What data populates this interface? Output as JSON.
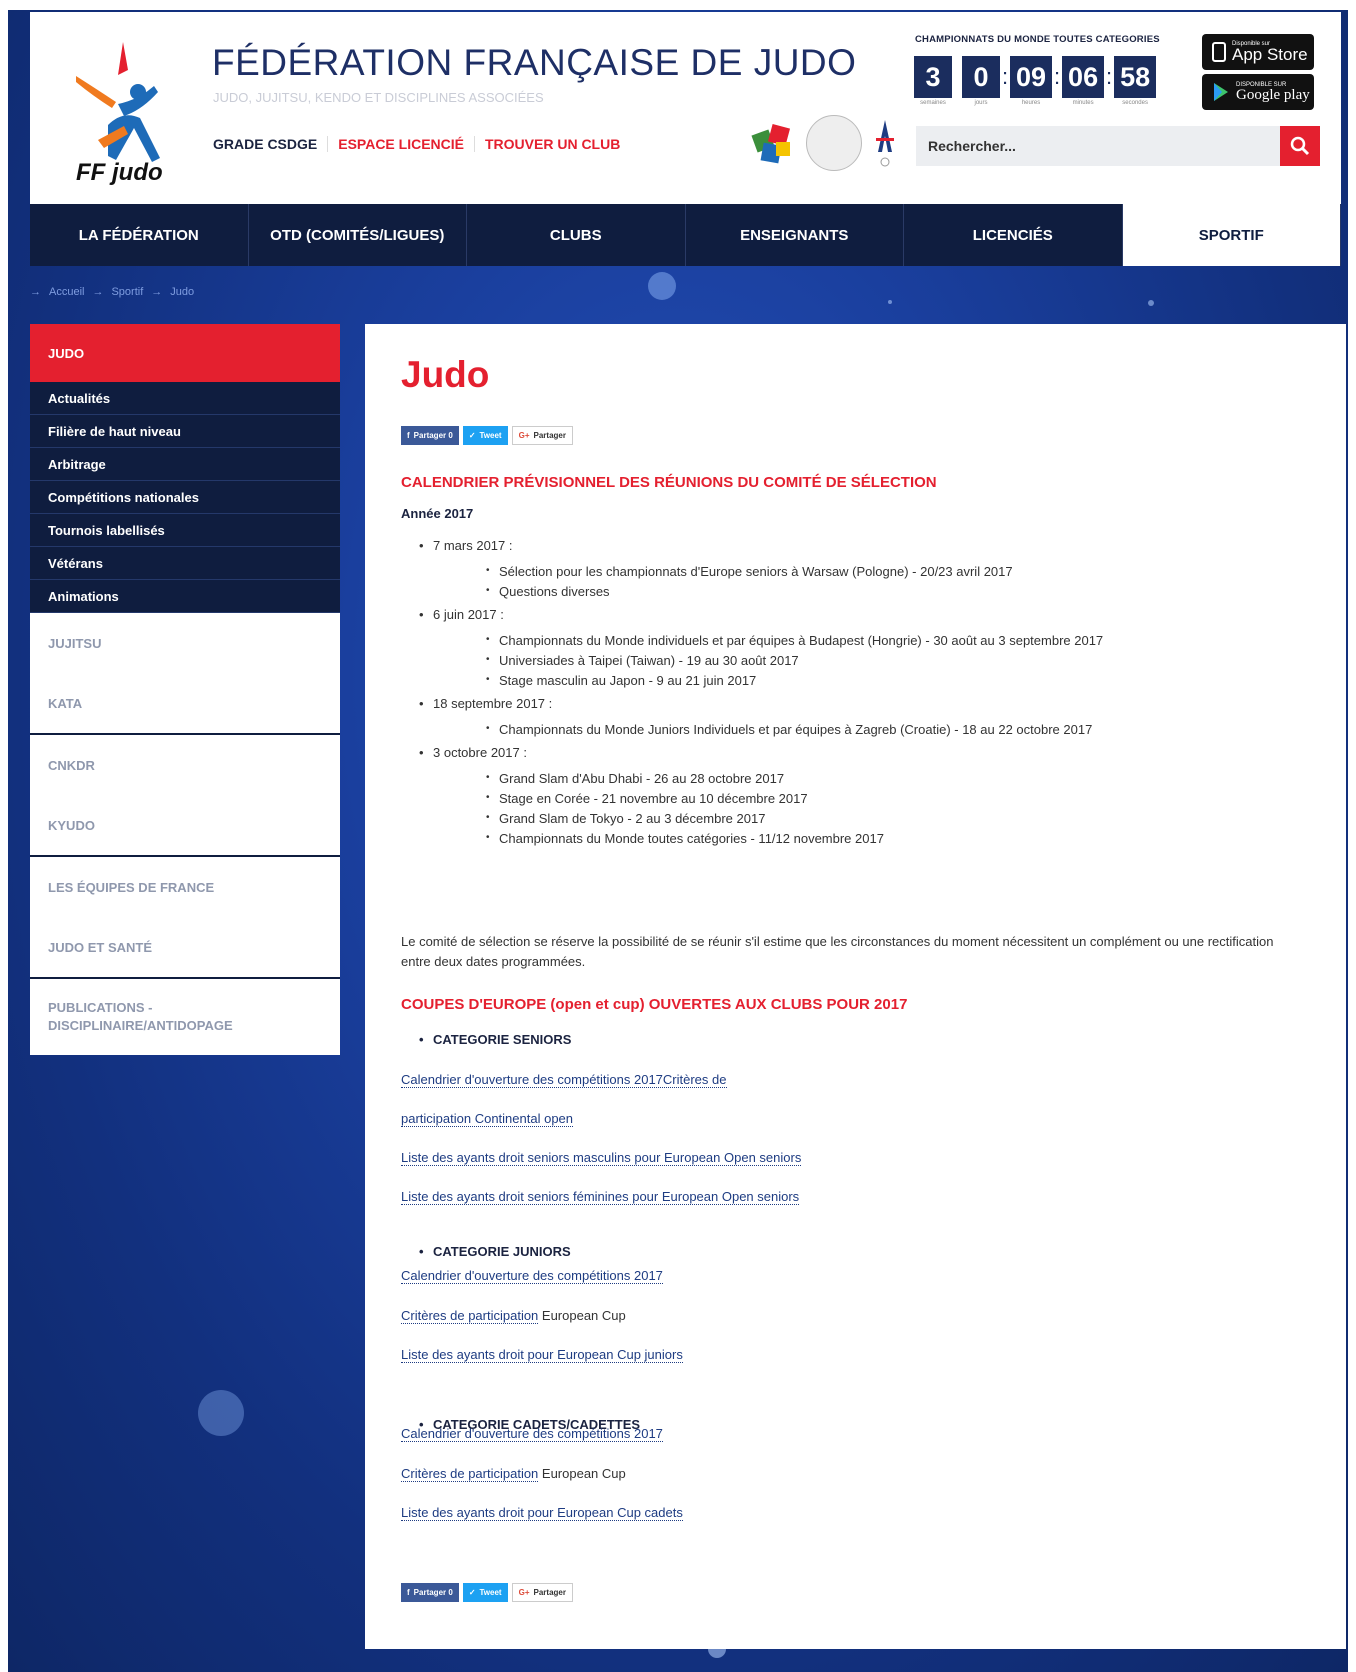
{
  "header": {
    "site_title": "FÉDÉRATION FRANÇAISE DE JUDO",
    "site_subtitle": "JUDO, JUJITSU, KENDO ET DISCIPLINES ASSOCIÉES",
    "logo_text": "FF judo",
    "top_links": [
      "GRADE CSDGE",
      "ESPACE LICENCIÉ",
      "TROUVER UN CLUB"
    ],
    "countdown_title": "CHAMPIONNATS DU MONDE TOUTES CATEGORIES",
    "countdown": [
      {
        "value": "3",
        "label": "semaines"
      },
      {
        "value": "0",
        "label": "jours"
      },
      {
        "value": "09",
        "label": "heures"
      },
      {
        "value": "06",
        "label": "minutes"
      },
      {
        "value": "58",
        "label": "secondes"
      }
    ],
    "app_store_label": "App Store",
    "app_store_small": "Disponible sur",
    "google_play_label": "Google play",
    "google_play_small": "DISPONIBLE SUR",
    "search_placeholder": "Rechercher..."
  },
  "nav": [
    "LA FÉDÉRATION",
    "OTD (COMITÉS/LIGUES)",
    "CLUBS",
    "ENSEIGNANTS",
    "LICENCIÉS",
    "SPORTIF"
  ],
  "breadcrumb": [
    "Accueil",
    "Sportif",
    "Judo"
  ],
  "sidebar": {
    "head": "JUDO",
    "sub_items": [
      "Actualités",
      "Filière de haut niveau",
      "Arbitrage",
      "Compétitions nationales",
      "Tournois labellisés",
      "Vétérans",
      "Animations"
    ],
    "groups": [
      [
        "JUJITSU",
        "KATA"
      ],
      [
        "CNKDR",
        "KYUDO"
      ],
      [
        "LES ÉQUIPES DE FRANCE",
        "JUDO ET SANTÉ"
      ],
      [
        "PUBLICATIONS - DISCIPLINAIRE/ANTIDOPAGE"
      ]
    ]
  },
  "content": {
    "title": "Judo",
    "share": {
      "fb": "Partager 0",
      "tw": "Tweet",
      "gp": "Partager"
    },
    "section1_title": "CALENDRIER PRÉVISIONNEL DES RÉUNIONS DU COMITÉ DE SÉLECTION",
    "year": "Année 2017",
    "meetings": [
      {
        "date": "7 mars 2017 :",
        "items": [
          "Sélection pour les championnats d'Europe seniors à Warsaw (Pologne) - 20/23 avril 2017",
          "Questions diverses"
        ]
      },
      {
        "date": "6 juin 2017 :",
        "items": [
          "Championnats du Monde individuels et par équipes à Budapest (Hongrie) - 30 août au 3 septembre 2017",
          "Universiades à Taipei (Taiwan) - 19 au 30 août 2017",
          "Stage masculin au Japon - 9 au 21 juin 2017"
        ]
      },
      {
        "date": "18 septembre 2017 :",
        "items": [
          "Championnats du Monde Juniors Individuels et par équipes à Zagreb (Croatie) - 18 au 22 octobre 2017"
        ]
      },
      {
        "date": "3 octobre 2017 :",
        "items": [
          "Grand Slam d'Abu Dhabi - 26 au 28 octobre 2017",
          "Stage en Corée - 21 novembre au 10 décembre 2017",
          "Grand Slam de Tokyo - 2 au 3 décembre 2017",
          "Championnats du Monde toutes catégories - 11/12 novembre 2017"
        ]
      }
    ],
    "note": "Le comité de sélection se réserve la possibilité de se réunir s'il estime que les circonstances du moment nécessitent un complément ou une rectification entre deux dates programmées.",
    "section2_title": "COUPES D'EUROPE (open et cup) OUVERTES AUX CLUBS POUR 2017",
    "categories": [
      {
        "name": "CATEGORIE SENIORS",
        "links": [
          {
            "link": "Calendrier d'ouverture des compétitions 2017Critères de",
            "tail": ""
          },
          {
            "link": "participation Continental open",
            "tail": ""
          },
          {
            "link": "Liste des ayants droit seniors masculins pour European Open seniors",
            "tail": ""
          },
          {
            "link": "Liste des ayants droit seniors féminines pour European Open seniors",
            "tail": ""
          }
        ]
      },
      {
        "name": "CATEGORIE JUNIORS",
        "links": [
          {
            "link": "Calendrier d'ouverture des compétitions 2017",
            "tail": ""
          },
          {
            "link": "Critères de participation",
            "tail": " European Cup"
          },
          {
            "link": "Liste des ayants droit pour European Cup juniors",
            "tail": ""
          }
        ]
      },
      {
        "name": "CATEGORIE CADETS/CADETTES",
        "links": [
          {
            "link": "Calendrier d'ouverture des compétitions 2017",
            "tail": ""
          },
          {
            "link": "Critères de participation",
            "tail": " European Cup"
          },
          {
            "link": "Liste des ayants droit pour European Cup cadets",
            "tail": ""
          }
        ]
      }
    ]
  },
  "colors": {
    "accent": "#e4202f",
    "navy": "#0f1d3f",
    "link": "#1e3c82"
  }
}
